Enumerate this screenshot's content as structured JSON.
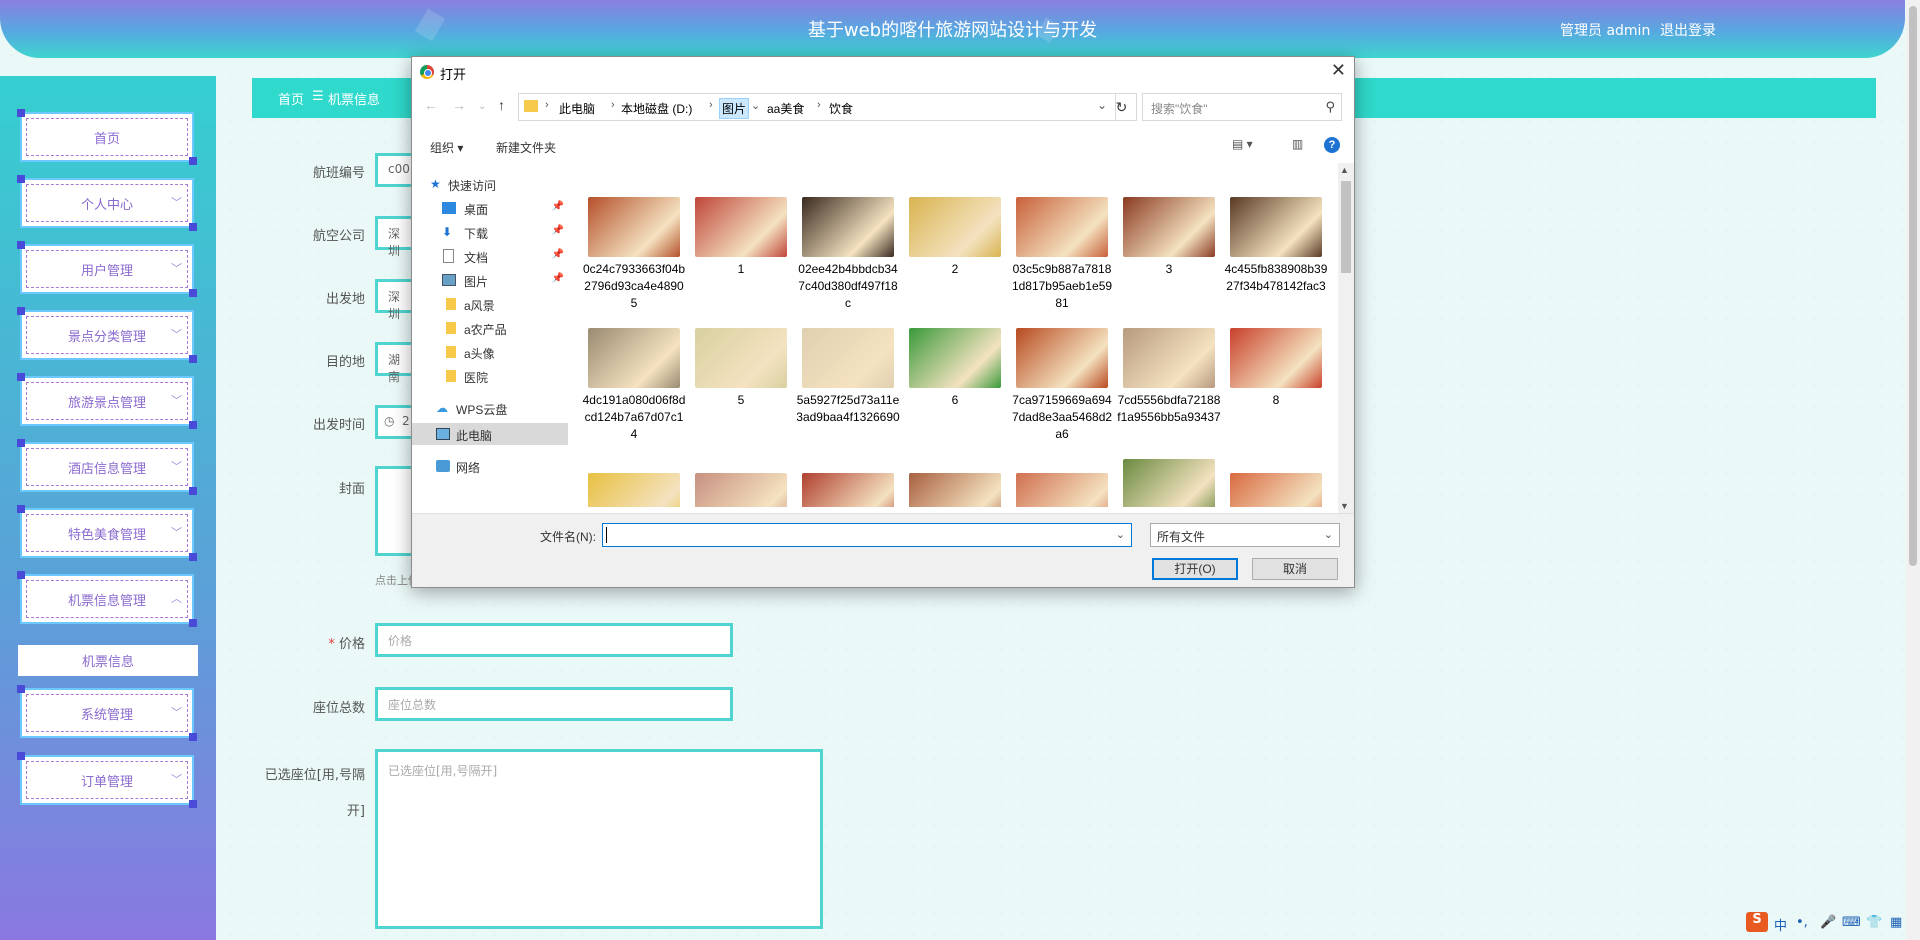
{
  "header": {
    "title": "基于web的喀什旅游网站设计与开发",
    "admin": "管理员 admin",
    "logout": "退出登录"
  },
  "sidebar": {
    "items": [
      {
        "label": "首页"
      },
      {
        "label": "个人中心"
      },
      {
        "label": "用户管理"
      },
      {
        "label": "景点分类管理"
      },
      {
        "label": "旅游景点管理"
      },
      {
        "label": "酒店信息管理"
      },
      {
        "label": "特色美食管理"
      },
      {
        "label": "机票信息管理"
      },
      {
        "label": "系统管理"
      },
      {
        "label": "订单管理"
      }
    ],
    "submenu": "机票信息"
  },
  "breadcrumb": {
    "home": "首页",
    "separator": "☰",
    "current": "机票信息"
  },
  "form": {
    "flight_no_label": "航班编号",
    "flight_no_value": "c00",
    "airline_label": "航空公司",
    "airline_value": "深圳",
    "departure_label": "出发地",
    "departure_value": "深圳",
    "destination_label": "目的地",
    "destination_value": "湖南",
    "depart_time_label": "出发时间",
    "depart_time_value": "2",
    "cover_label": "封面",
    "upload_hint": "点击上传",
    "price_required": "*",
    "price_label": "价格",
    "price_placeholder": "价格",
    "seats_label": "座位总数",
    "seats_placeholder": "座位总数",
    "selected_seats_label": "已选座位[用,号隔开]",
    "selected_seats_placeholder": "已选座位[用,号隔开]"
  },
  "dialog": {
    "title": "打开",
    "close": "✕",
    "address": [
      "此电脑",
      "本地磁盘 (D:)",
      "图片",
      "aa美食",
      "饮食"
    ],
    "search_placeholder": "搜索\"饮食\"",
    "toolbar": {
      "organize": "组织 ▾",
      "new_folder": "新建文件夹",
      "help": "?"
    },
    "nav": [
      {
        "label": "快速访问",
        "icon": "star-icon",
        "pinned": false
      },
      {
        "label": "桌面",
        "icon": "desktop-icon",
        "pinned": true
      },
      {
        "label": "下载",
        "icon": "download-icon",
        "pinned": true
      },
      {
        "label": "文档",
        "icon": "document-icon",
        "pinned": true
      },
      {
        "label": "图片",
        "icon": "picture-icon",
        "pinned": true
      },
      {
        "label": "a风景",
        "icon": "folder-icon",
        "pinned": false
      },
      {
        "label": "a农产品",
        "icon": "folder-icon",
        "pinned": false
      },
      {
        "label": "a头像",
        "icon": "folder-icon",
        "pinned": false
      },
      {
        "label": "医院",
        "icon": "folder-icon",
        "pinned": false
      },
      {
        "label": "WPS云盘",
        "icon": "cloud-icon",
        "pinned": false
      },
      {
        "label": "此电脑",
        "icon": "computer-icon",
        "pinned": false
      },
      {
        "label": "网络",
        "icon": "network-icon",
        "pinned": false
      }
    ],
    "files": [
      {
        "name": "0c24c7933663f04b2796d93ca4e48905",
        "color": "#b5502a"
      },
      {
        "name": "1",
        "color": "#c0453a"
      },
      {
        "name": "02ee42b4bbdcb347c40d380df497f18c",
        "color": "#3a2a20"
      },
      {
        "name": "2",
        "color": "#d8b450"
      },
      {
        "name": "03c5c9b887a78181d817b95aeb1e5981",
        "color": "#c8603a"
      },
      {
        "name": "3",
        "color": "#8a3a22"
      },
      {
        "name": "4c455fb838908b3927f34b478142fac3",
        "color": "#5a3a24"
      },
      {
        "name": "4dc191a080d06f8dcd124b7a67d07c14",
        "color": "#9a8a70"
      },
      {
        "name": "5",
        "color": "#d8d0a0"
      },
      {
        "name": "5a5927f25d73a11e3ad9baa4f1326690",
        "color": "#e0d0b0"
      },
      {
        "name": "6",
        "color": "#3a9a3a"
      },
      {
        "name": "7ca97159669a6947dad8e3aa5468d2a6",
        "color": "#b84a20"
      },
      {
        "name": "7cd5556bdfa72188f1a9556bb5a93437",
        "color": "#b89a80"
      },
      {
        "name": "8",
        "color": "#c8402a"
      }
    ],
    "partial_colors": [
      "#e8c040",
      "#c89080",
      "#b04030",
      "#a86040",
      "#d07050",
      "#6a8a40",
      "#d86a40"
    ],
    "filename_label": "文件名(N):",
    "filename_value": "",
    "filetype": "所有文件",
    "open": "打开(O)",
    "cancel": "取消"
  },
  "ime": {
    "logo": "S",
    "lang": "中",
    "punct": "•,",
    "mic": "🎤",
    "keyboard": "⌨",
    "shirt": "👕",
    "grid": "▦"
  }
}
